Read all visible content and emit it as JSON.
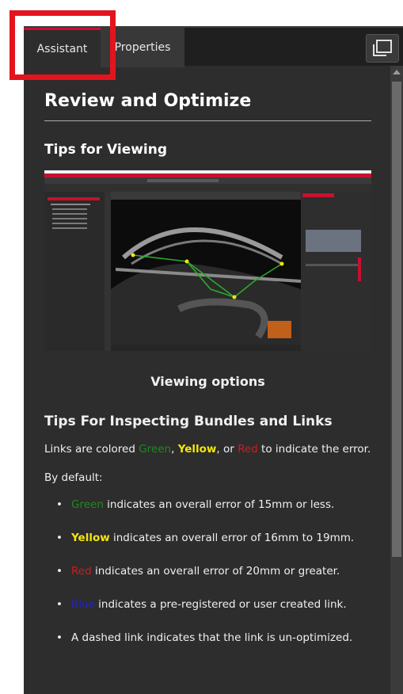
{
  "tabs": {
    "assistant": "Assistant",
    "properties": "Properties"
  },
  "window_button_icon": "restore-window-icon",
  "content": {
    "title": "Review and Optimize",
    "tips_viewing_heading": "Tips for Viewing",
    "image_caption": "Viewing options",
    "tips_inspecting_heading": "Tips For Inspecting Bundles and Links",
    "links_text": {
      "prefix": "Links are colored ",
      "green": "Green",
      "sep1": ", ",
      "yellow": "Yellow",
      "sep2": ", or ",
      "red": "Red",
      "suffix": " to indicate the error."
    },
    "default_label": "By default:",
    "bullets": {
      "green": {
        "color_word": "Green",
        "text": " indicates an overall error of 15mm or less."
      },
      "yellow": {
        "color_word": "Yellow",
        "text": " indicates an overall error of 16mm to 19mm."
      },
      "red": {
        "color_word": "Red",
        "text": " indicates an overall error of 20mm or greater."
      },
      "blue": {
        "color_word": "Blue",
        "text": " indicates a pre-registered or user created link."
      },
      "dashed": {
        "text": "A dashed link indicates that the link is un-optimized."
      }
    }
  },
  "colors": {
    "panel_bg": "#2d2d2d",
    "accent_red": "#c8102e",
    "highlight_box": "#e3141e",
    "link_green": "#1f8a1f",
    "link_yellow": "#f3e60c",
    "link_red": "#d11b1b",
    "link_blue": "#2323c8"
  }
}
